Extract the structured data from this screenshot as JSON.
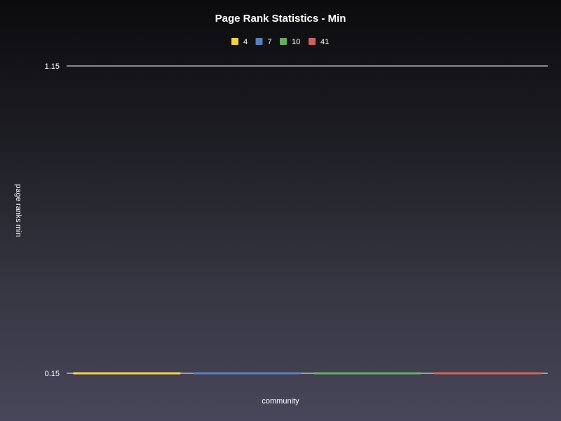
{
  "chart_data": {
    "type": "bar",
    "title": "Page Rank Statistics - Min",
    "xlabel": "community",
    "ylabel": "page ranks min",
    "ylim": [
      0.15,
      1.15
    ],
    "y_ticks": [
      "1.15",
      "0.15"
    ],
    "grid": true,
    "legend_position": "top-center",
    "series": [
      {
        "name": "4",
        "value": 0.15,
        "color": "#f4cf4a"
      },
      {
        "name": "7",
        "value": 0.15,
        "color": "#5c7fb7"
      },
      {
        "name": "10",
        "value": 0.15,
        "color": "#6aab62"
      },
      {
        "name": "41",
        "value": 0.15,
        "color": "#cc6260"
      }
    ]
  }
}
